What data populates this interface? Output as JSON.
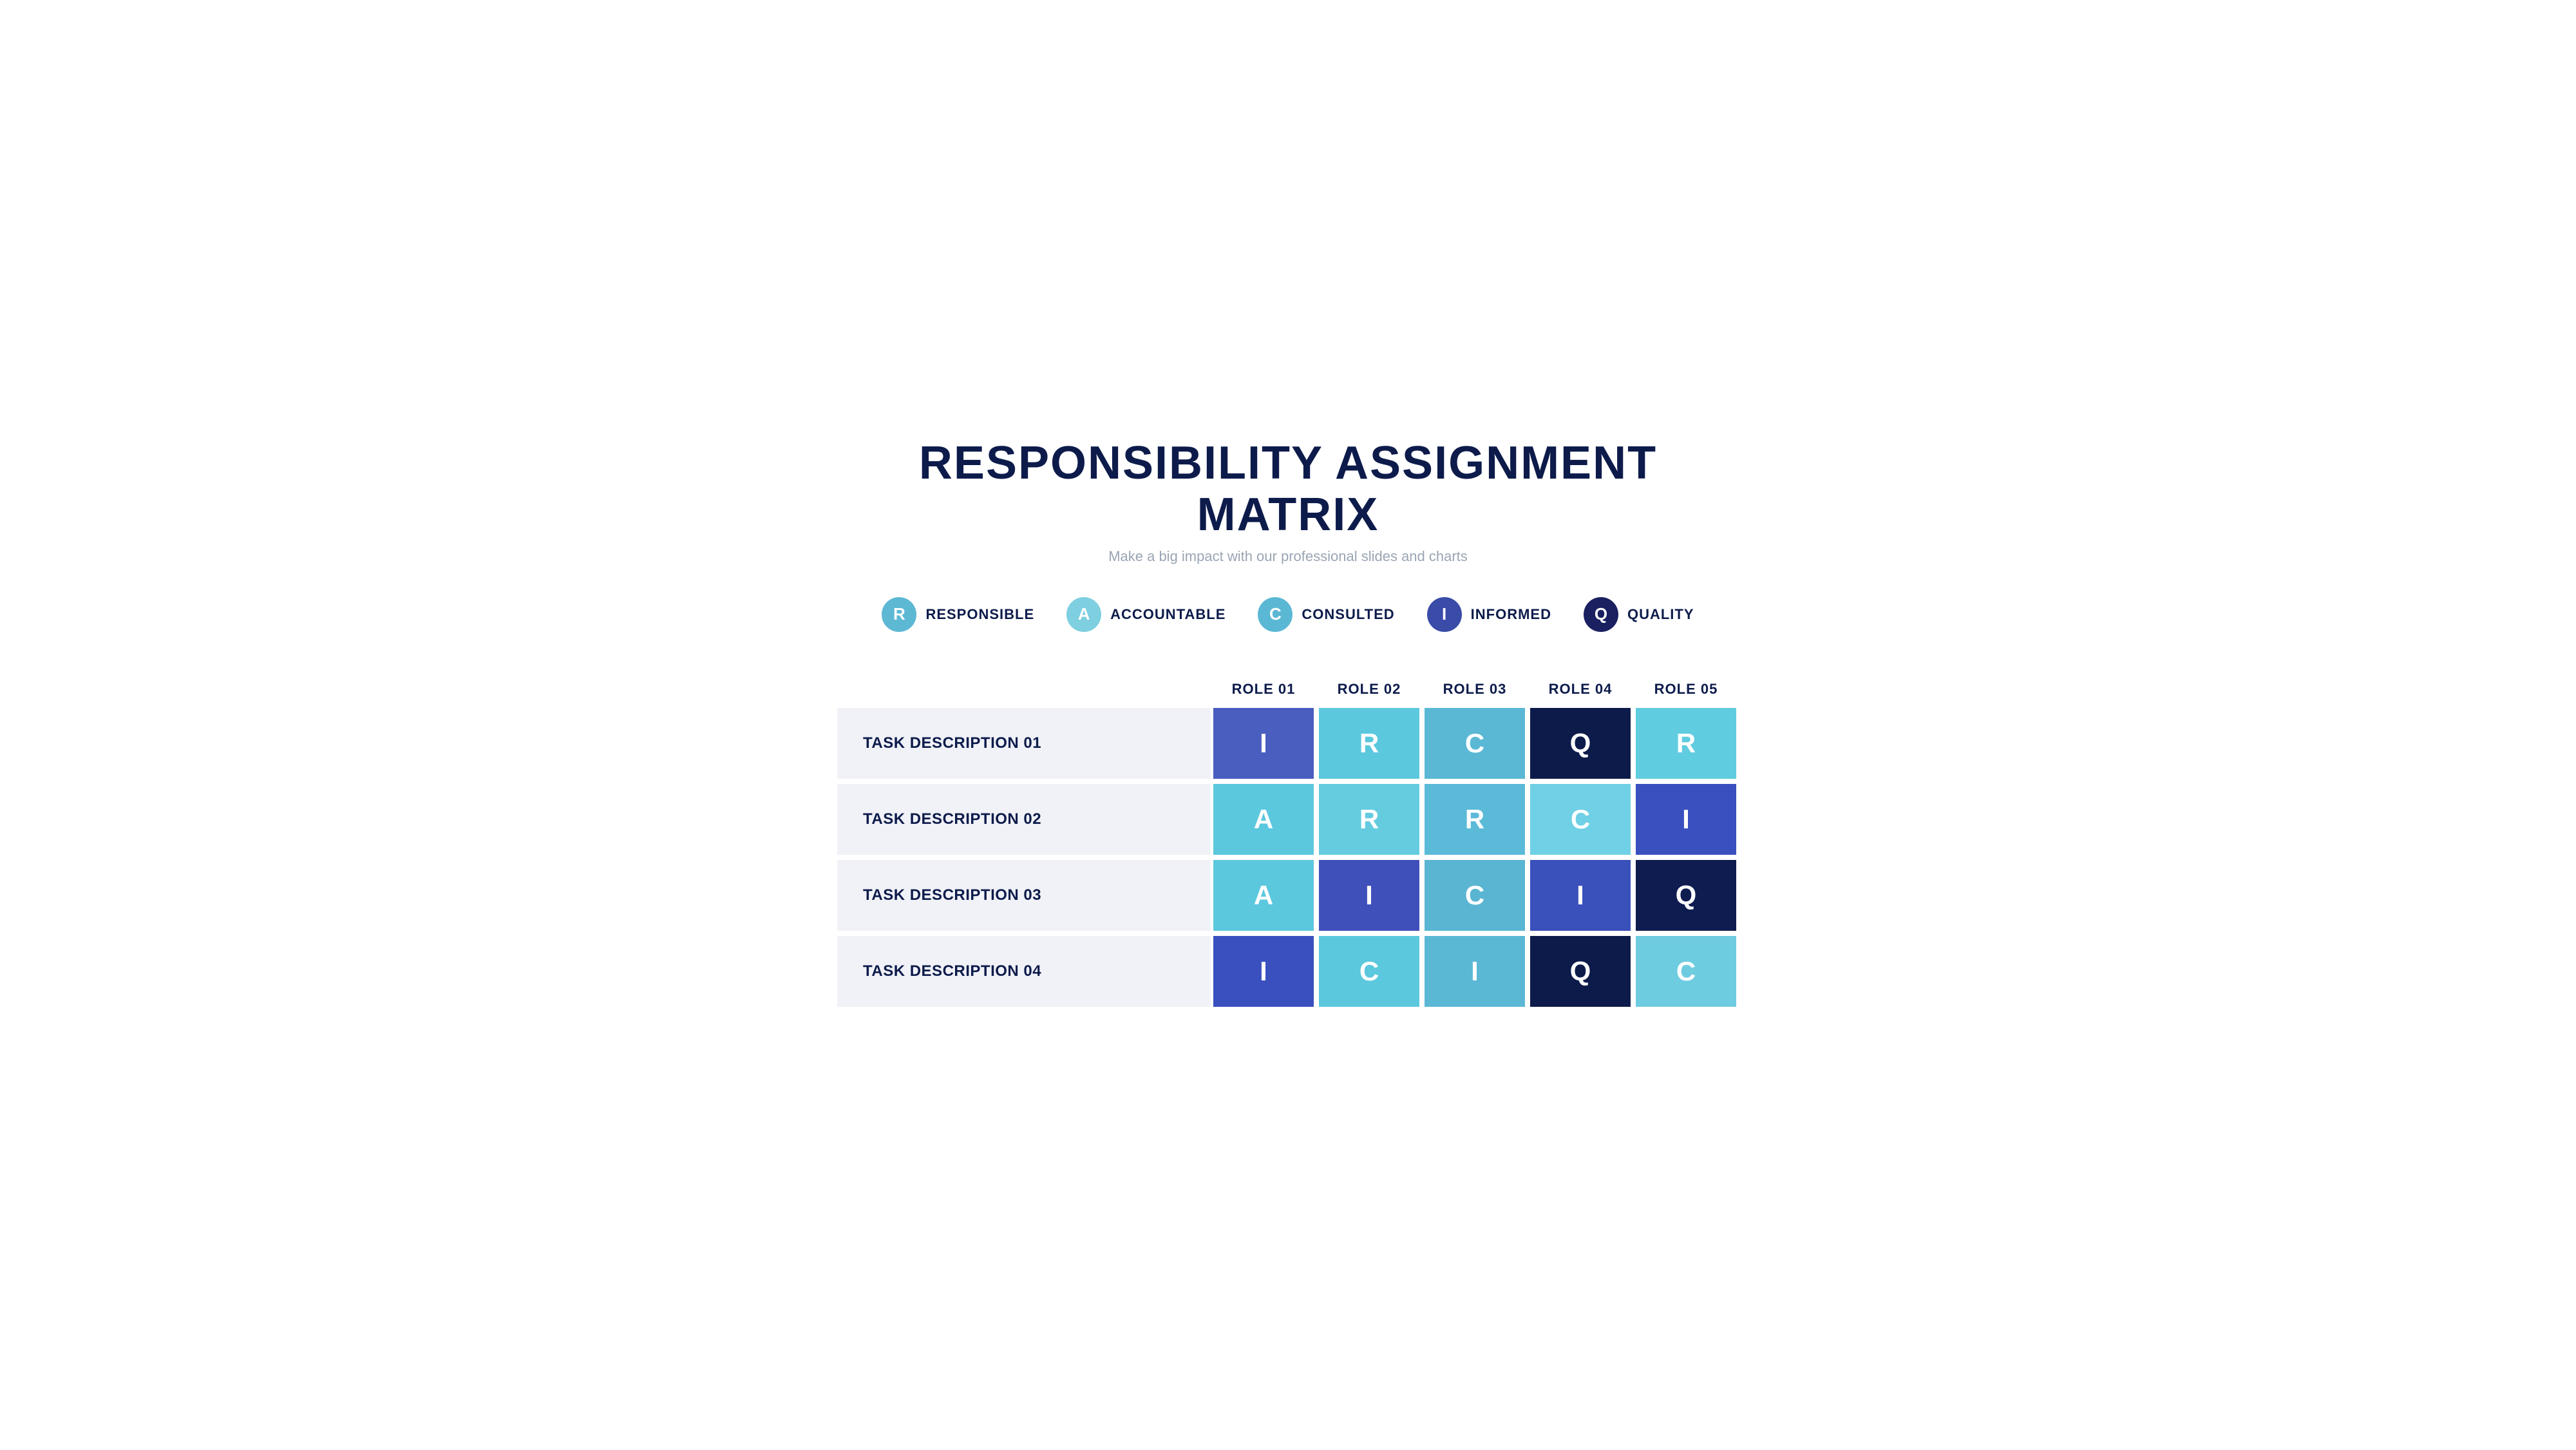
{
  "header": {
    "title": "RESPONSIBILITY ASSIGNMENT MATRIX",
    "subtitle": "Make a big impact with our professional slides and charts"
  },
  "legend": {
    "items": [
      {
        "id": "R",
        "label": "RESPONSIBLE",
        "badge_class": "badge-r"
      },
      {
        "id": "A",
        "label": "ACCOUNTABLE",
        "badge_class": "badge-a"
      },
      {
        "id": "C",
        "label": "CONSULTED",
        "badge_class": "badge-c"
      },
      {
        "id": "I",
        "label": "INFORMED",
        "badge_class": "badge-i"
      },
      {
        "id": "Q",
        "label": "QUALITY",
        "badge_class": "badge-q"
      }
    ]
  },
  "matrix": {
    "column_headers": [
      "",
      "ROLE 01",
      "ROLE 02",
      "ROLE 03",
      "ROLE 04",
      "ROLE 05"
    ],
    "rows": [
      {
        "task": "TASK DESCRIPTION 01",
        "cells": [
          {
            "value": "I",
            "color_class": "r1c1"
          },
          {
            "value": "R",
            "color_class": "r1c2"
          },
          {
            "value": "C",
            "color_class": "r1c3"
          },
          {
            "value": "Q",
            "color_class": "r1c4"
          },
          {
            "value": "R",
            "color_class": "r1c5"
          }
        ]
      },
      {
        "task": "TASK DESCRIPTION 02",
        "cells": [
          {
            "value": "A",
            "color_class": "r2c1"
          },
          {
            "value": "R",
            "color_class": "r2c2"
          },
          {
            "value": "R",
            "color_class": "r2c3"
          },
          {
            "value": "C",
            "color_class": "r2c4"
          },
          {
            "value": "I",
            "color_class": "r2c5"
          }
        ]
      },
      {
        "task": "TASK DESCRIPTION 03",
        "cells": [
          {
            "value": "A",
            "color_class": "r3c1"
          },
          {
            "value": "I",
            "color_class": "r3c2"
          },
          {
            "value": "C",
            "color_class": "r3c3"
          },
          {
            "value": "I",
            "color_class": "r3c4"
          },
          {
            "value": "Q",
            "color_class": "r3c5"
          }
        ]
      },
      {
        "task": "TASK DESCRIPTION 04",
        "cells": [
          {
            "value": "I",
            "color_class": "r4c1"
          },
          {
            "value": "C",
            "color_class": "r4c2"
          },
          {
            "value": "I",
            "color_class": "r4c3"
          },
          {
            "value": "Q",
            "color_class": "r4c4"
          },
          {
            "value": "C",
            "color_class": "r4c5"
          }
        ]
      }
    ]
  }
}
